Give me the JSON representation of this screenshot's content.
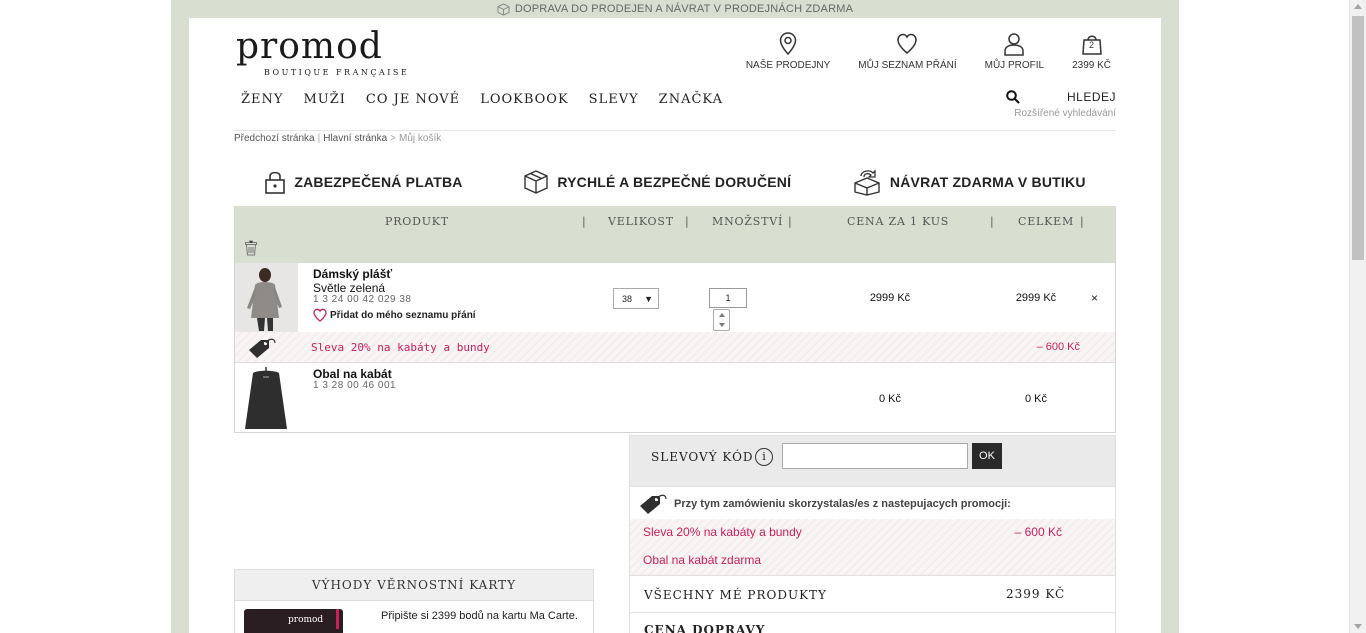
{
  "banner": {
    "text": "DOPRAVA DO PRODEJEN A NÁVRAT V PRODEJNÁCH ZDARMA"
  },
  "logo": {
    "word": "promod",
    "tagline": "BOUTIQUE FRANÇAISE"
  },
  "header": {
    "stores": "NAŠE PRODEJNY",
    "wishlist": "MŮJ SEZNAM PŘÁNÍ",
    "profile": "MŮJ PROFIL",
    "cart_count": "2",
    "cart_total": "2399 KČ"
  },
  "nav": [
    "ŽENY",
    "MUŽI",
    "CO JE NOVÉ",
    "LOOKBOOK",
    "SLEVY",
    "ZNAČKA"
  ],
  "search": {
    "label": "HLEDEJ",
    "advanced": "Rozšířené vyhledávání"
  },
  "breadcrumb": {
    "prev": "Předchozí stránka",
    "home": "Hlavní stránka",
    "current": "Můj košík"
  },
  "trust": {
    "secure": "ZABEZPEČENÁ PLATBA",
    "delivery": "RYCHLÉ A BEZPEČNÉ DORUČENÍ",
    "return": "NÁVRAT ZDARMA V BUTIKU"
  },
  "table": {
    "headers": [
      "PRODUKT",
      "VELIKOST",
      "MNOŽSTVÍ",
      "CENA ZA 1 KUS",
      "CELKEM"
    ]
  },
  "items": [
    {
      "name": "Dámský plášť",
      "color": "Světle zelená",
      "code": "1 3 24 00 42 029 38",
      "wishlist": "Přidat do mého seznamu přání",
      "size": "38",
      "qty": "1",
      "unit_price": "2999 Kč",
      "total": "2999 Kč",
      "remove": "×"
    },
    {
      "name": "Obal na kabát",
      "code": "1 3 28 00 46 001",
      "unit_price": "0 Kč",
      "total": "0 Kč"
    }
  ],
  "discount": {
    "label": "Sleva 20% na kabáty a bundy",
    "value": "–  600 Kč"
  },
  "coupon": {
    "label": "SLEVOVÝ KÓD",
    "info": "i",
    "button": "OK",
    "value": ""
  },
  "promos": {
    "title": "Przy tym zamówieniu skorzystalas/es z nastepujacych promocji:",
    "items": [
      {
        "label": "Sleva 20% na kabáty a bundy",
        "value": "–  600 Kč"
      },
      {
        "label": "Obal na kabát zdarma",
        "value": ""
      }
    ]
  },
  "summary": {
    "all_label": "VŠECHNY MÉ PRODUKTY",
    "all_value": "2399 KČ",
    "shipping_label": "CENA DOPRAVY"
  },
  "loyalty": {
    "title": "VÝHODY VĚRNOSTNÍ KARTY",
    "card_text": "promod",
    "text": "Připište si 2399 bodů na kartu Ma Carte."
  },
  "colors": {
    "accent": "#c8205a",
    "header_bg": "#d8dfd0",
    "button_dark": "#2a2a2a"
  }
}
